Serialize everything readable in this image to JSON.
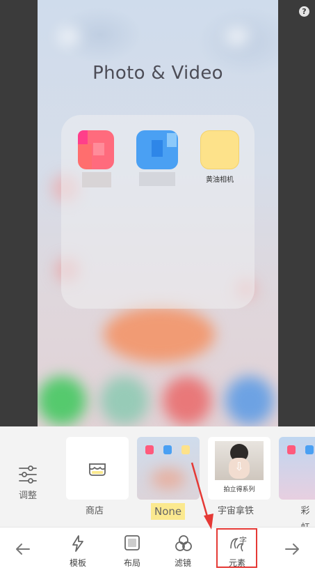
{
  "preview": {
    "folder_title": "Photo & Video",
    "apps": [
      {
        "label": ""
      },
      {
        "label": ""
      },
      {
        "label": "黄油相机"
      }
    ],
    "help_icon": "?"
  },
  "filter_strip": {
    "adjust_label": "调整",
    "items": [
      {
        "label": "商店"
      },
      {
        "label": "None"
      },
      {
        "label": "宇宙拿铁"
      },
      {
        "label": "彩虹"
      }
    ],
    "latte_caption": "拍立得系列"
  },
  "toolbar": {
    "items": [
      {
        "label": "模板"
      },
      {
        "label": "布局"
      },
      {
        "label": "滤镜"
      },
      {
        "label": "元素"
      }
    ]
  },
  "colors": {
    "highlight": "#e53935",
    "none_label_bg": "#fbe98f",
    "app_yellow": "#fde28a"
  }
}
